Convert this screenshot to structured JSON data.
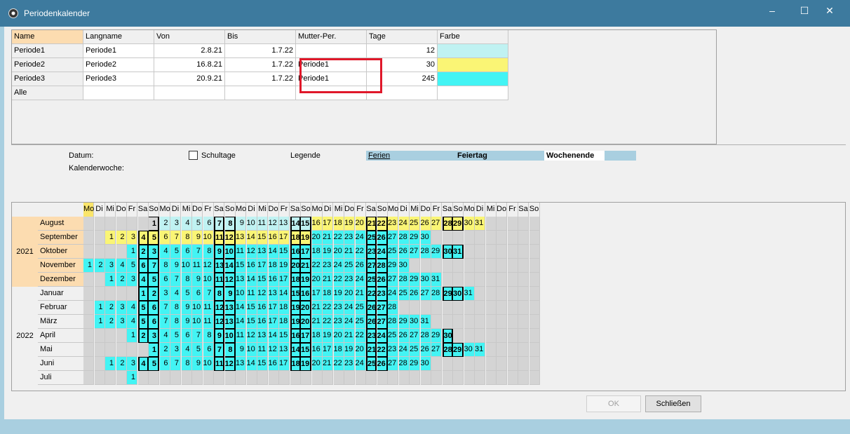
{
  "window": {
    "title": "Periodenkalender",
    "min": "–",
    "max": "☐",
    "close": "✕"
  },
  "grid": {
    "headers": [
      "Name",
      "Langname",
      "Von",
      "Bis",
      "Mutter-Per.",
      "Tage",
      "Farbe"
    ],
    "rows": [
      {
        "name": "Periode1",
        "langname": "Periode1",
        "von": "2.8.21",
        "bis": "1.7.22",
        "mutter": "",
        "tage": "12",
        "farbe": "#c0f2f2"
      },
      {
        "name": "Periode2",
        "langname": "Periode2",
        "von": "16.8.21",
        "bis": "1.7.22",
        "mutter": "Periode1",
        "tage": "30",
        "farbe": "#faf575"
      },
      {
        "name": "Periode3",
        "langname": "Periode3",
        "von": "20.9.21",
        "bis": "1.7.22",
        "mutter": "Periode1",
        "tage": "245",
        "farbe": "#43f4f4"
      },
      {
        "name": "Alle",
        "langname": "",
        "von": "",
        "bis": "",
        "mutter": "",
        "tage": "",
        "farbe": "#ffffff"
      }
    ]
  },
  "info": {
    "datum_label": "Datum:",
    "kw_label": "Kalenderwoche:",
    "schultage_label": "Schultage",
    "legende_label": "Legende",
    "legend_ferien": "Ferien",
    "legend_feiertag": "Feiertag",
    "legend_wochenende": "Wochenende"
  },
  "calendar": {
    "weekdays": [
      "Mo",
      "Di",
      "Mi",
      "Do",
      "Fr",
      "Sa",
      "So"
    ],
    "years": [
      "2021",
      "2022"
    ],
    "months": [
      {
        "name": "August",
        "year": "2021",
        "offset": 6,
        "days": 31
      },
      {
        "name": "September",
        "year": "2021",
        "offset": 2,
        "days": 30
      },
      {
        "name": "Oktober",
        "year": "2021",
        "offset": 4,
        "days": 31
      },
      {
        "name": "November",
        "year": "2021",
        "offset": 0,
        "days": 30
      },
      {
        "name": "Dezember",
        "year": "2021",
        "offset": 2,
        "days": 31
      },
      {
        "name": "Januar",
        "year": "2022",
        "offset": 5,
        "days": 31
      },
      {
        "name": "Februar",
        "year": "2022",
        "offset": 1,
        "days": 28
      },
      {
        "name": "März",
        "year": "2022",
        "offset": 1,
        "days": 31
      },
      {
        "name": "April",
        "year": "2022",
        "offset": 4,
        "days": 30
      },
      {
        "name": "Mai",
        "year": "2022",
        "offset": 6,
        "days": 31
      },
      {
        "name": "Juni",
        "year": "2022",
        "offset": 2,
        "days": 30
      },
      {
        "name": "Juli",
        "year": "2022",
        "offset": 4,
        "days": 1
      }
    ]
  },
  "buttons": {
    "ok": "OK",
    "close": "Schließen"
  }
}
